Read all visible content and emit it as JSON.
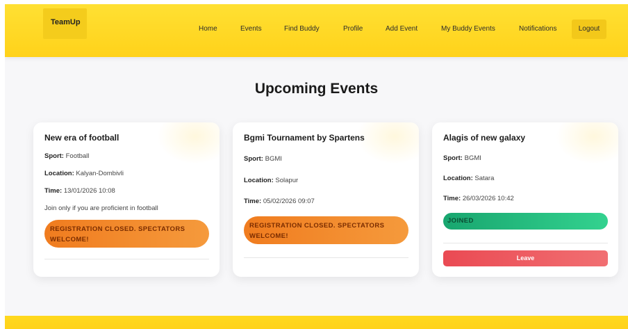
{
  "brand": {
    "logo_text": "TeamUp"
  },
  "nav": {
    "items": [
      {
        "label": "Home"
      },
      {
        "label": "Events"
      },
      {
        "label": "Find Buddy"
      },
      {
        "label": "Profile"
      },
      {
        "label": "Add Event"
      },
      {
        "label": "My Buddy Events"
      },
      {
        "label": "Notifications"
      }
    ],
    "logout_label": "Logout"
  },
  "page": {
    "title": "Upcoming Events"
  },
  "labels": {
    "sport": "Sport:",
    "location": "Location:",
    "time": "Time:"
  },
  "events": [
    {
      "title": "New era of football",
      "sport": "Football",
      "location": "Kalyan-Dombivli",
      "time": "13/01/2026 10:08",
      "description": "Join only if you are proficient in football",
      "status_line1": "REGISTRATION CLOSED. SPECTATORS",
      "status_line2": "WELCOME!"
    },
    {
      "title": "Bgmi Tournament by Spartens",
      "sport": "BGMI",
      "location": "Solapur",
      "time": "05/02/2026 09:07",
      "status_line1": "REGISTRATION CLOSED. SPECTATORS",
      "status_line2": "WELCOME!"
    },
    {
      "title": "Alagis of new galaxy",
      "sport": "BGMI",
      "location": "Satara",
      "time": "26/03/2026 10:42",
      "status": "JOINED",
      "action_label": "Leave"
    }
  ],
  "colors": {
    "navbar": "#ffd21a",
    "closed_badge": "#f07c1f",
    "joined_badge": "#18a66f",
    "leave_button": "#ea4a53"
  }
}
